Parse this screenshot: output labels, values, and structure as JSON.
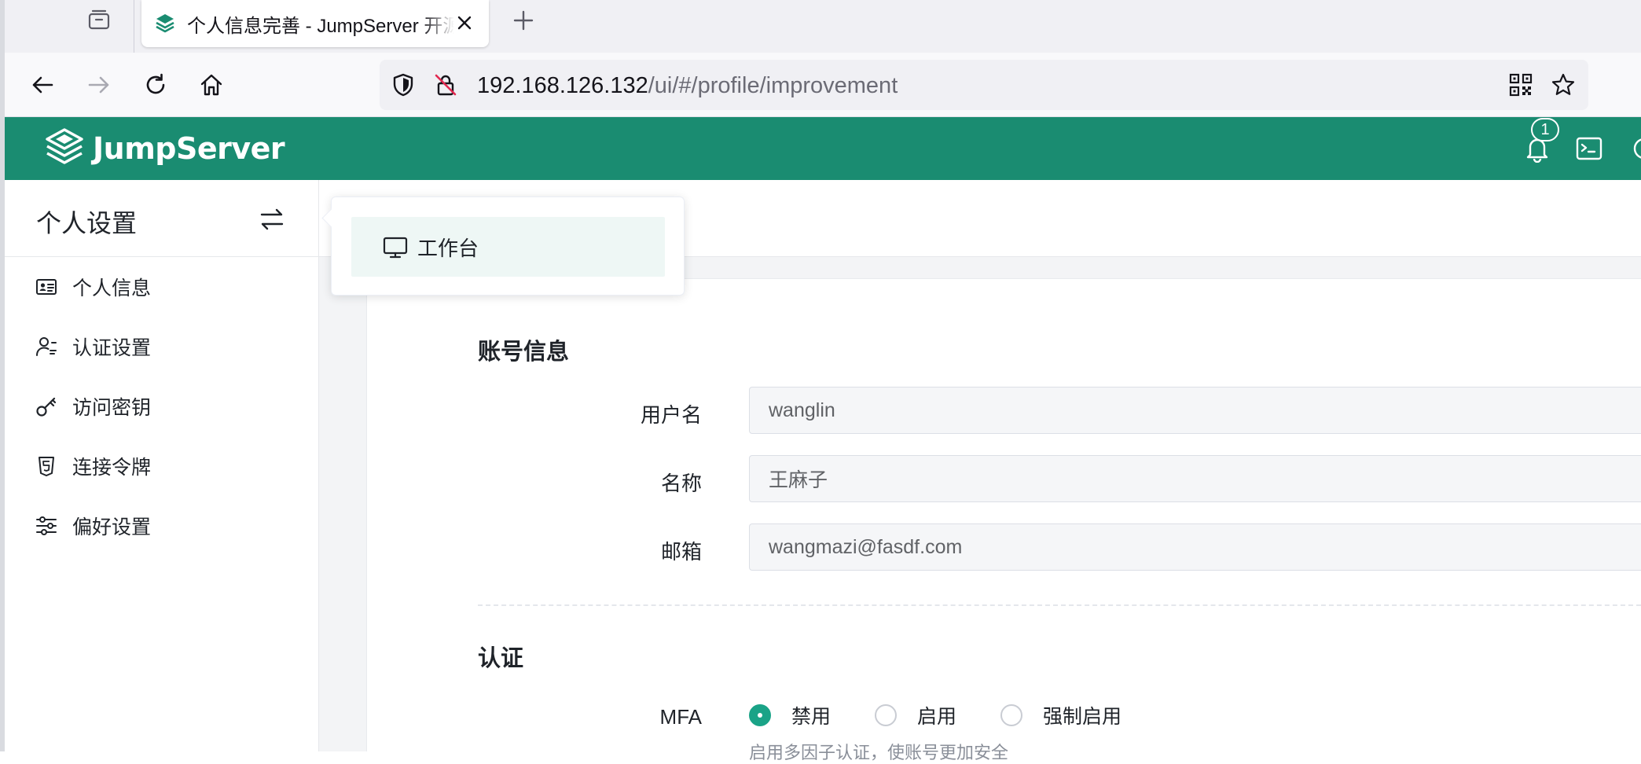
{
  "browser": {
    "tab_title": "个人信息完善 - JumpServer 开源堡垒机",
    "url_host": "192.168.126.132",
    "url_path": "/ui/#/profile/improvement"
  },
  "header": {
    "logo_text": "JumpServer",
    "notification_count": "1",
    "brand_color": "#1a8c71"
  },
  "sidebar": {
    "title": "个人设置",
    "items": [
      {
        "label": "个人信息",
        "icon": "id-card-icon"
      },
      {
        "label": "认证设置",
        "icon": "user-settings-icon"
      },
      {
        "label": "访问密钥",
        "icon": "key-icon"
      },
      {
        "label": "连接令牌",
        "icon": "token-icon"
      },
      {
        "label": "偏好设置",
        "icon": "sliders-icon"
      }
    ]
  },
  "popover": {
    "items": [
      {
        "label": "工作台",
        "icon": "monitor-icon"
      }
    ]
  },
  "form": {
    "account_section_title": "账号信息",
    "username": {
      "label": "用户名",
      "value": "wanglin"
    },
    "name": {
      "label": "名称",
      "value": "王麻子"
    },
    "email": {
      "label": "邮箱",
      "value": "wangmazi@fasdf.com"
    },
    "auth_section_title": "认证",
    "mfa": {
      "label": "MFA",
      "options": [
        "禁用",
        "启用",
        "强制启用"
      ],
      "selected": "禁用",
      "hint": "启用多因子认证，使账号更加安全"
    }
  }
}
